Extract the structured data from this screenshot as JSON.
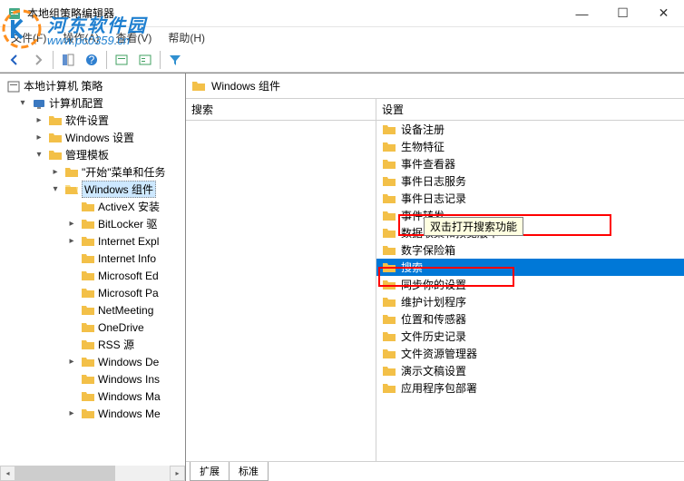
{
  "titlebar": {
    "title": "本地组策略编辑器"
  },
  "menubar": {
    "file": "文件(F)",
    "action": "操作(A)",
    "view": "查看(V)",
    "help": "帮助(H)"
  },
  "watermark": {
    "cn": "河东软件园",
    "url": "www.pc0359.cn"
  },
  "tree": {
    "root": "本地计算机 策略",
    "n1": "计算机配置",
    "n2": "软件设置",
    "n3": "Windows 设置",
    "n4": "管理模板",
    "n5": "\"开始\"菜单和任务",
    "n6": "Windows 组件",
    "n7": "ActiveX 安装",
    "n8": "BitLocker 驱",
    "n9": "Internet Expl",
    "n10": "Internet Info",
    "n11": "Microsoft Ed",
    "n12": "Microsoft Pa",
    "n13": "NetMeeting",
    "n14": "OneDrive",
    "n15": "RSS 源",
    "n16": "Windows De",
    "n17": "Windows Ins",
    "n18": "Windows Ma",
    "n19": "Windows Me"
  },
  "content": {
    "header": "Windows 组件",
    "colLeft": "搜索",
    "colRight": "设置",
    "items": {
      "i1": "设备注册",
      "i2": "生物特征",
      "i3": "事件查看器",
      "i4": "事件日志服务",
      "i5": "事件日志记录",
      "i6": "事件转发",
      "i7": "数据收集和预览版本",
      "i8": "数字保险箱",
      "i9": "搜索",
      "i10": "同步你的设置",
      "i11": "维护计划程序",
      "i12": "位置和传感器",
      "i13": "文件历史记录",
      "i14": "文件资源管理器",
      "i15": "演示文稿设置",
      "i16": "应用程序包部署"
    },
    "tooltip": "双击打开搜索功能"
  },
  "tabs": {
    "extended": "扩展",
    "standard": "标准"
  }
}
